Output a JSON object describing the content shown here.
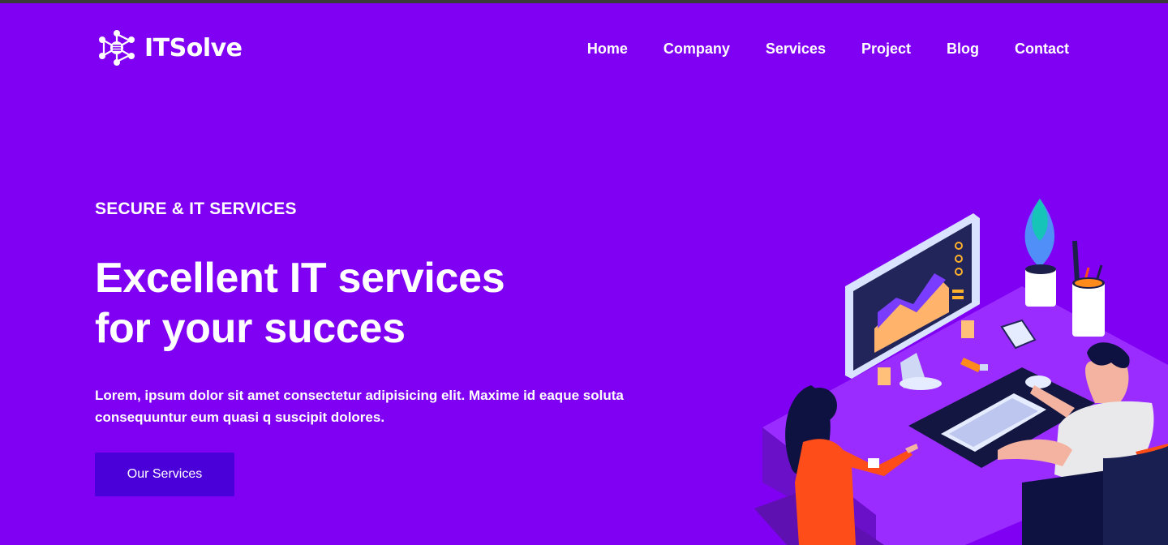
{
  "brand": {
    "name": "ITSolve",
    "logo_icon": "network-hub-icon"
  },
  "nav": {
    "items": [
      {
        "label": "Home"
      },
      {
        "label": "Company"
      },
      {
        "label": "Services"
      },
      {
        "label": "Project"
      },
      {
        "label": "Blog"
      },
      {
        "label": "Contact"
      }
    ]
  },
  "hero": {
    "eyebrow": "SECURE & IT SERVICES",
    "headline_line1": "Excellent IT services",
    "headline_line2": "for your succes",
    "lead": "Lorem, ipsum dolor sit amet consectetur adipisicing elit. Maxime id eaque soluta consequuntur eum quasi q suscipit dolores.",
    "cta_label": "Our Services",
    "illustration": "team-working-at-computer-desk-illustration"
  },
  "colors": {
    "background": "#8000f3",
    "button": "#4a00d8",
    "text": "#ffffff"
  }
}
